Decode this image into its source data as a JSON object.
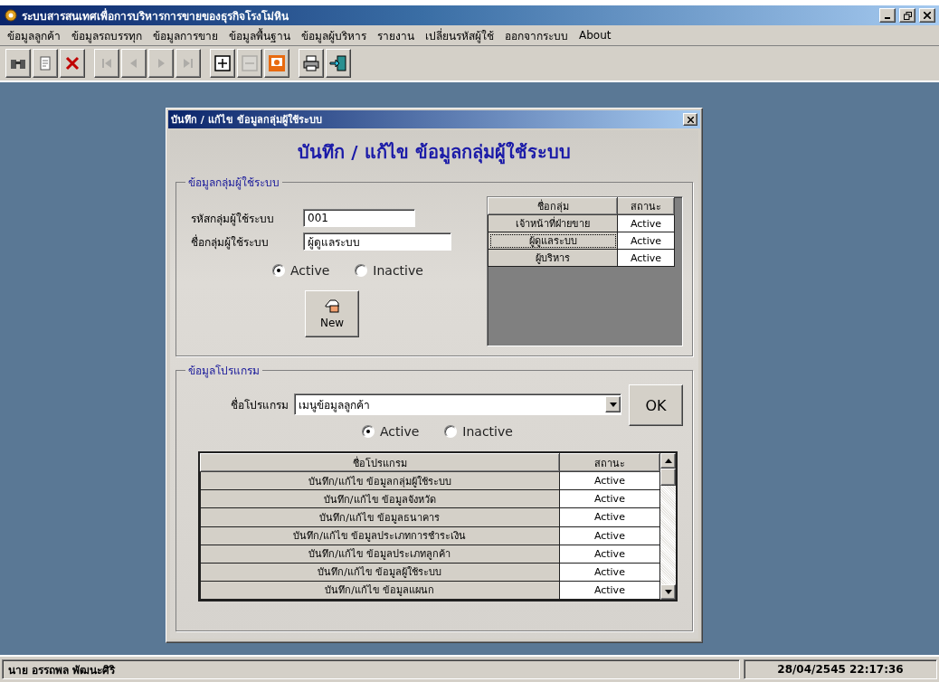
{
  "window": {
    "title": "ระบบสารสนเทศเพื่อการบริหารการขายของธุรกิจโรงโม่หิน"
  },
  "menu": [
    "ข้อมูลลูกค้า",
    "ข้อมูลรถบรรทุก",
    "ข้อมูลการขาย",
    "ข้อมูลพื้นฐาน",
    "ข้อมูลผู้บริหาร",
    "รายงาน",
    "เปลี่ยนรหัสผู้ใช้",
    "ออกจากระบบ",
    "About"
  ],
  "toolbar": [
    {
      "kind": "find",
      "disabled": false
    },
    {
      "kind": "document",
      "disabled": false
    },
    {
      "kind": "delete",
      "disabled": false
    },
    {
      "kind": "first",
      "disabled": true
    },
    {
      "kind": "prev",
      "disabled": true
    },
    {
      "kind": "next",
      "disabled": true
    },
    {
      "kind": "last",
      "disabled": true
    },
    {
      "kind": "add",
      "disabled": false
    },
    {
      "kind": "remove",
      "disabled": true
    },
    {
      "kind": "picture",
      "disabled": false
    },
    {
      "kind": "print",
      "disabled": false
    },
    {
      "kind": "exit",
      "disabled": false
    }
  ],
  "dialog": {
    "title": "บันทึก / แก้ไข ข้อมูลกลุ่มผู้ใช้ระบบ",
    "heading": "บันทึก / แก้ไข ข้อมูลกลุ่มผู้ใช้ระบบ",
    "group_section": {
      "legend": "ข้อมูลกลุ่มผู้ใช้ระบบ",
      "fields": [
        {
          "label": "รหัสกลุ่มผู้ใช้ระบบ",
          "value": "001"
        },
        {
          "label": "ชื่อกลุ่มผู้ใช้ระบบ",
          "value": "ผู้ดูแลระบบ"
        }
      ],
      "radios": [
        {
          "label": "Active",
          "selected": true
        },
        {
          "label": "Inactive",
          "selected": false
        }
      ],
      "new_button": "New",
      "table": {
        "columns": [
          "ชื่อกลุ่ม",
          "สถานะ"
        ],
        "rows": [
          {
            "cells": [
              "เจ้าหน้าที่ฝ่ายขาย",
              "Active"
            ],
            "selected": false
          },
          {
            "cells": [
              "ผู้ดูแลระบบ",
              "Active"
            ],
            "selected": true
          },
          {
            "cells": [
              "ผู้บริหาร",
              "Active"
            ],
            "selected": false
          }
        ]
      }
    },
    "program_section": {
      "legend": "ข้อมูลโปรแกรม",
      "program_label": "ชื่อโปรแกรม",
      "program_value": "เมนูข้อมูลลูกค้า",
      "ok_button": "OK",
      "radios": [
        {
          "label": "Active",
          "selected": true
        },
        {
          "label": "Inactive",
          "selected": false
        }
      ],
      "table": {
        "columns": [
          "ชื่อโปรแกรม",
          "สถานะ"
        ],
        "rows": [
          [
            "บันทึก/แก้ไข ข้อมูลกลุ่มผู้ใช้ระบบ",
            "Active"
          ],
          [
            "บันทึก/แก้ไข ข้อมูลจังหวัด",
            "Active"
          ],
          [
            "บันทึก/แก้ไข ข้อมูลธนาคาร",
            "Active"
          ],
          [
            "บันทึก/แก้ไข ข้อมูลประเภทการชำระเงิน",
            "Active"
          ],
          [
            "บันทึก/แก้ไข ข้อมูลประเภทลูกค้า",
            "Active"
          ],
          [
            "บันทึก/แก้ไข ข้อมูลผู้ใช้ระบบ",
            "Active"
          ],
          [
            "บันทึก/แก้ไข ข้อมูลแผนก",
            "Active"
          ]
        ]
      }
    }
  },
  "status_bar": {
    "user": "นาย อรรถพล พัฒนะศิริ",
    "datetime": "28/04/2545 22:17:36"
  }
}
